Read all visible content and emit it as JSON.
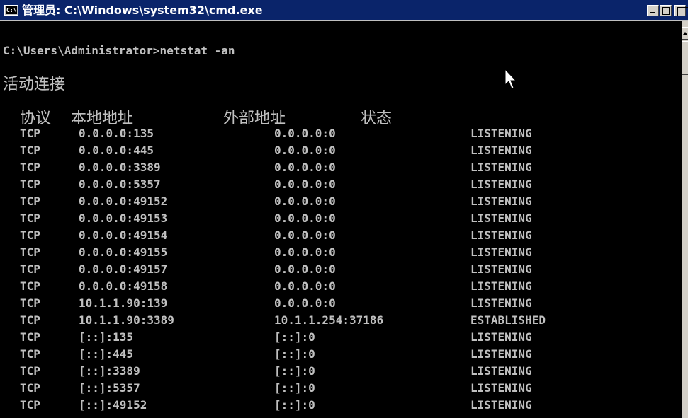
{
  "window": {
    "title": "管理员: C:\\Windows\\system32\\cmd.exe",
    "icon_label": "C:\\",
    "buttons": {
      "minimize": "minimize-icon",
      "maximize": "maximize-icon",
      "close": "close-icon"
    }
  },
  "console": {
    "prompt": "C:\\Users\\Administrator>netstat -an",
    "section_title": "活动连接",
    "headers": {
      "proto": "协议",
      "local": "本地地址",
      "remote": "外部地址",
      "state": "状态"
    },
    "rows": [
      {
        "proto": "TCP",
        "local": "0.0.0.0:135",
        "remote": "0.0.0.0:0",
        "state": "LISTENING"
      },
      {
        "proto": "TCP",
        "local": "0.0.0.0:445",
        "remote": "0.0.0.0:0",
        "state": "LISTENING"
      },
      {
        "proto": "TCP",
        "local": "0.0.0.0:3389",
        "remote": "0.0.0.0:0",
        "state": "LISTENING"
      },
      {
        "proto": "TCP",
        "local": "0.0.0.0:5357",
        "remote": "0.0.0.0:0",
        "state": "LISTENING"
      },
      {
        "proto": "TCP",
        "local": "0.0.0.0:49152",
        "remote": "0.0.0.0:0",
        "state": "LISTENING"
      },
      {
        "proto": "TCP",
        "local": "0.0.0.0:49153",
        "remote": "0.0.0.0:0",
        "state": "LISTENING"
      },
      {
        "proto": "TCP",
        "local": "0.0.0.0:49154",
        "remote": "0.0.0.0:0",
        "state": "LISTENING"
      },
      {
        "proto": "TCP",
        "local": "0.0.0.0:49155",
        "remote": "0.0.0.0:0",
        "state": "LISTENING"
      },
      {
        "proto": "TCP",
        "local": "0.0.0.0:49157",
        "remote": "0.0.0.0:0",
        "state": "LISTENING"
      },
      {
        "proto": "TCP",
        "local": "0.0.0.0:49158",
        "remote": "0.0.0.0:0",
        "state": "LISTENING"
      },
      {
        "proto": "TCP",
        "local": "10.1.1.90:139",
        "remote": "0.0.0.0:0",
        "state": "LISTENING"
      },
      {
        "proto": "TCP",
        "local": "10.1.1.90:3389",
        "remote": "10.1.1.254:37186",
        "state": "ESTABLISHED"
      },
      {
        "proto": "TCP",
        "local": "[::]:135",
        "remote": "[::]:0",
        "state": "LISTENING"
      },
      {
        "proto": "TCP",
        "local": "[::]:445",
        "remote": "[::]:0",
        "state": "LISTENING"
      },
      {
        "proto": "TCP",
        "local": "[::]:3389",
        "remote": "[::]:0",
        "state": "LISTENING"
      },
      {
        "proto": "TCP",
        "local": "[::]:5357",
        "remote": "[::]:0",
        "state": "LISTENING"
      },
      {
        "proto": "TCP",
        "local": "[::]:49152",
        "remote": "[::]:0",
        "state": "LISTENING"
      }
    ]
  },
  "colors": {
    "titlebar": "#0a246a",
    "console_bg": "#000000",
    "console_text": "#c0c0c0"
  },
  "icons": {
    "cursor": "mouse-pointer-icon",
    "app": "cmd-app-icon"
  }
}
